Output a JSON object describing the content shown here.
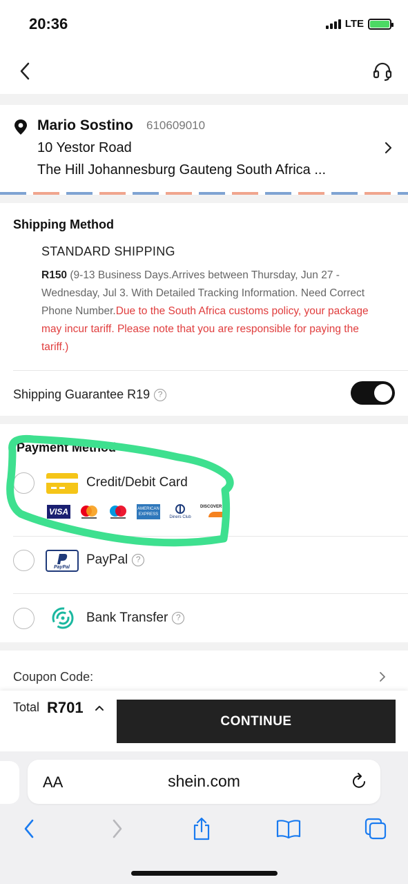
{
  "status_bar": {
    "time": "20:36",
    "network": "LTE"
  },
  "address": {
    "name": "Mario Sostino",
    "phone": "610609010",
    "line1": "10 Yestor Road",
    "line2": "The Hill Johannesburg Gauteng South Africa ..."
  },
  "shipping": {
    "title": "Shipping Method",
    "method": "STANDARD SHIPPING",
    "price": "R150",
    "details": " (9-13 Business Days.Arrives between Thursday, Jun 27 - Wednesday, Jul 3. With Detailed Tracking Information. Need Correct Phone Number.",
    "warning": "Due to the South Africa customs policy, your package may incur tariff. Please note that you are responsible for paying the tariff.)",
    "guarantee_label": "Shipping Guarantee R19",
    "guarantee_enabled": true
  },
  "payment": {
    "title": "Payment Method",
    "options": [
      {
        "label": "Credit/Debit Card",
        "icon": "credit-card-icon",
        "selected": false
      },
      {
        "label": "PayPal",
        "icon": "paypal-icon",
        "selected": false
      },
      {
        "label": "Bank Transfer",
        "icon": "bank-transfer-icon",
        "selected": false
      }
    ],
    "card_brands": {
      "visa": "VISA",
      "amex": "AMERICAN EXPRESS",
      "diners": "Diners Club",
      "discover": "DISCOVER",
      "paypal_logo": "PayPal"
    }
  },
  "coupon": {
    "label": "Coupon Code:"
  },
  "checkout": {
    "total_label": "Total",
    "total_amount": "R701",
    "continue_label": "CONTINUE"
  },
  "browser": {
    "aa": "AA",
    "url": "shein.com"
  },
  "colors": {
    "highlight": "#3ee08f",
    "warning": "#e03d3d",
    "button": "#222222",
    "browser_blue": "#1a7bf0"
  }
}
